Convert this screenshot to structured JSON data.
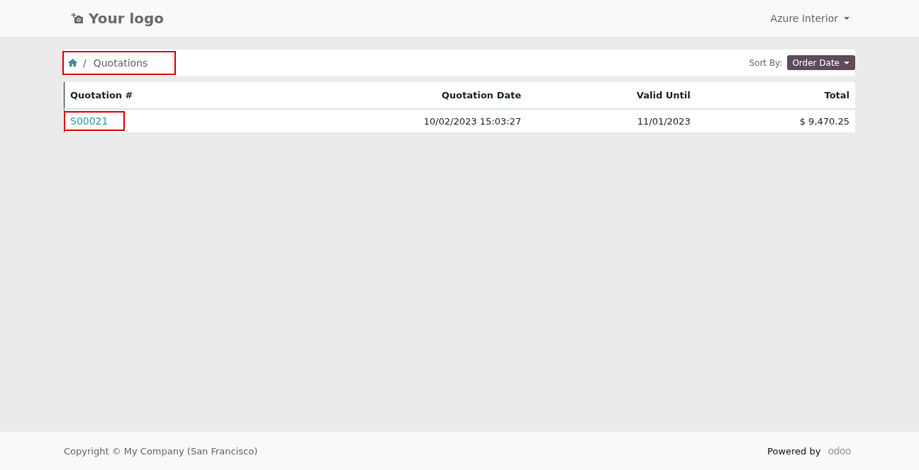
{
  "header": {
    "logo_text": "Your logo",
    "user_menu": "Azure Interior"
  },
  "breadcrumb": {
    "separator": "/",
    "current": "Quotations",
    "highlighted": true
  },
  "sort": {
    "label": "Sort By:",
    "value": "Order Date"
  },
  "table": {
    "columns": [
      "Quotation #",
      "Quotation Date",
      "Valid Until",
      "Total"
    ],
    "rows": [
      {
        "number": "S00021",
        "highlighted": true,
        "date": "10/02/2023 15:03:27",
        "valid_until": "11/01/2023",
        "total": "$ 9,470.25"
      }
    ]
  },
  "footer": {
    "copyright": "Copyright © My Company (San Francisco)",
    "powered_by": "Powered by",
    "brand": "odoo"
  }
}
